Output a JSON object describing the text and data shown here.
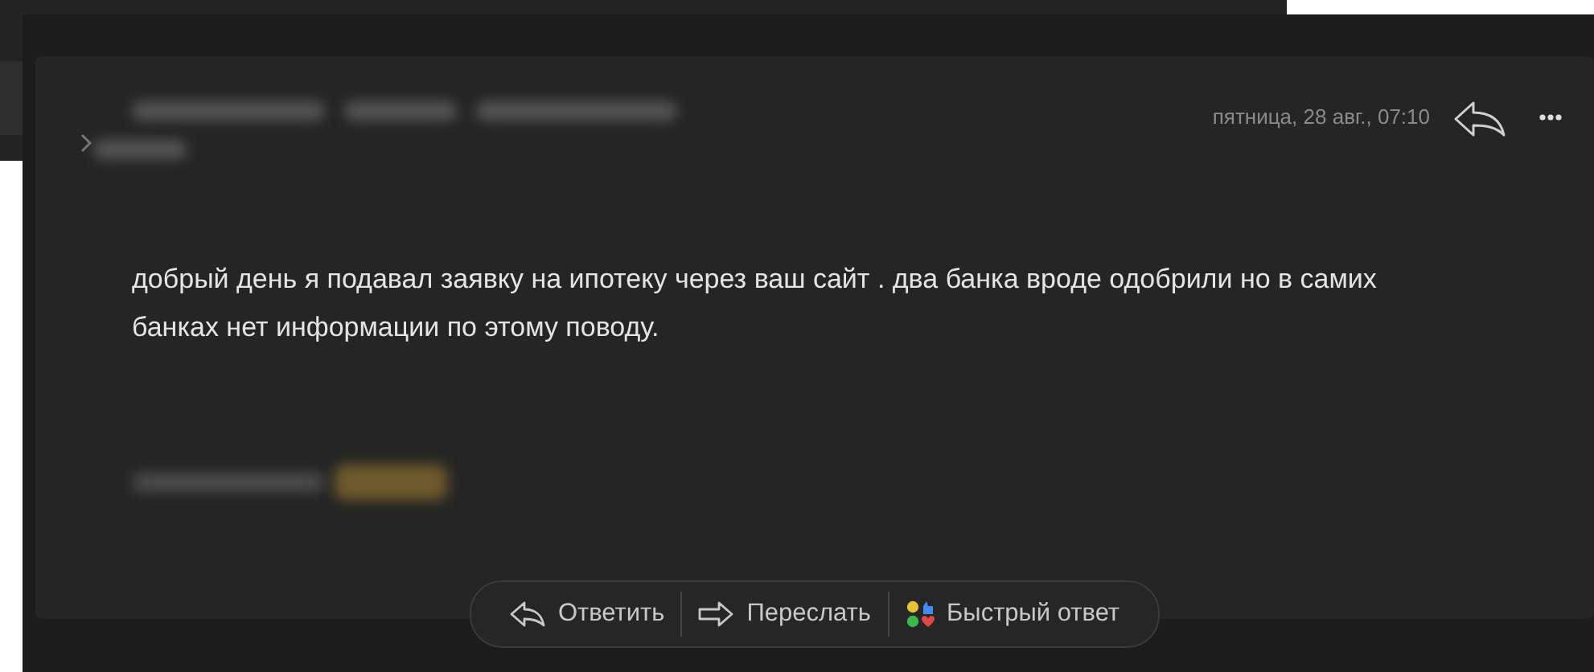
{
  "message": {
    "date": "пятница, 28 авг., 07:10",
    "body": "добрый день я подавал заявку на ипотеку через ваш сайт . два банка вроде одобрили но в самих банках нет информации по этому поводу."
  },
  "actions": [
    {
      "kind": "reply",
      "label": "Ответить"
    },
    {
      "kind": "forward",
      "label": "Переслать"
    },
    {
      "kind": "quick",
      "label": "Быстрый ответ"
    }
  ]
}
